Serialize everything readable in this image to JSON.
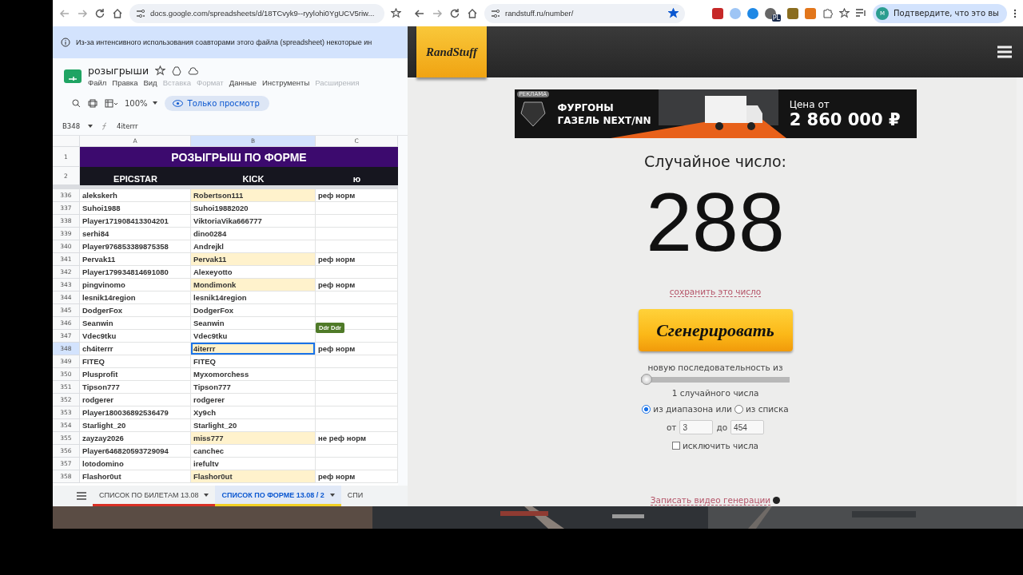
{
  "sheets_window": {
    "address": "docs.google.com/spreadsheets/d/18TCvyk9--ryylohi0YgUCV5riw...",
    "notice": "Из-за интенсивного использования соавторами этого файла (spreadsheet) некоторые ин",
    "doc_title": "розыгрыши",
    "menu": [
      {
        "label": "Файл",
        "disabled": false
      },
      {
        "label": "Правка",
        "disabled": false
      },
      {
        "label": "Вид",
        "disabled": false
      },
      {
        "label": "Вставка",
        "disabled": true
      },
      {
        "label": "Формат",
        "disabled": true
      },
      {
        "label": "Данные",
        "disabled": false
      },
      {
        "label": "Инструменты",
        "disabled": false
      },
      {
        "label": "Расширения",
        "disabled": true
      }
    ],
    "zoom": "100%",
    "view_mode": "Только просмотр",
    "cell_ref": "B348",
    "formula": "4iterrr",
    "columns": [
      {
        "label": "A",
        "selected": false
      },
      {
        "label": "B",
        "selected": true
      },
      {
        "label": "C",
        "selected": false
      }
    ],
    "title_row": {
      "number": "1",
      "text": "РОЗЫГРЫШ ПО ФОРМЕ"
    },
    "header_row": {
      "number": "2",
      "cells": [
        "EPICSTAR",
        "KICK",
        "ю"
      ]
    },
    "rows": [
      {
        "number": "336",
        "a": "alekskerh",
        "b": "Robertson111",
        "c": "реф норм",
        "highlighted": true,
        "selected": false
      },
      {
        "number": "337",
        "a": "Suhoi1988",
        "b": "Suhoi19882020",
        "highlighted": false,
        "selected": false
      },
      {
        "number": "338",
        "a": "Player171908413304201",
        "b": "ViktoriaVika666777",
        "highlighted": false,
        "selected": false
      },
      {
        "number": "339",
        "a": "serhi84",
        "b": "dino0284",
        "highlighted": false,
        "selected": false
      },
      {
        "number": "340",
        "a": "Player976853389875358",
        "b": "Andrejkl",
        "highlighted": false,
        "selected": false
      },
      {
        "number": "341",
        "a": "Pervak11",
        "b": "Pervak11",
        "c": "реф норм",
        "highlighted": true,
        "selected": false
      },
      {
        "number": "342",
        "a": "Player179934814691080",
        "b": "Alexeyotto",
        "highlighted": false,
        "selected": false
      },
      {
        "number": "343",
        "a": "pingvinomo",
        "b": "Mondimonk",
        "c": "реф норм",
        "highlighted": true,
        "selected": false
      },
      {
        "number": "344",
        "a": "lesnik14region",
        "b": "lesnik14region",
        "highlighted": false,
        "selected": false
      },
      {
        "number": "345",
        "a": "DodgerFox",
        "b": "DodgerFox",
        "highlighted": false,
        "selected": false
      },
      {
        "number": "346",
        "a": "Seanwin",
        "b": "Seanwin",
        "highlighted": false,
        "selected": false
      },
      {
        "number": "347",
        "a": "Vdec9tku",
        "b": "Vdec9tku",
        "flag": "Ddr Ddr",
        "highlighted": false,
        "selected": false
      },
      {
        "number": "348",
        "a": "ch4iterrr",
        "b": "4iterrr",
        "c": "реф норм",
        "highlighted": true,
        "selected": true
      },
      {
        "number": "349",
        "a": "FITEQ",
        "b": "FITEQ",
        "highlighted": false,
        "selected": false
      },
      {
        "number": "350",
        "a": "Plusprofit",
        "b": "Myxomorchess",
        "highlighted": false,
        "selected": false
      },
      {
        "number": "351",
        "a": "Tipson777",
        "b": "Tipson777",
        "highlighted": false,
        "selected": false
      },
      {
        "number": "352",
        "a": "rodgerer",
        "b": "rodgerer",
        "highlighted": false,
        "selected": false
      },
      {
        "number": "353",
        "a": "Player180036892536479",
        "b": "Xy9ch",
        "highlighted": false,
        "selected": false
      },
      {
        "number": "354",
        "a": "Starlight_20",
        "b": "Starlight_20",
        "highlighted": false,
        "selected": false
      },
      {
        "number": "355",
        "a": "zayzay2026",
        "b": "miss777",
        "c": "не реф норм",
        "highlighted": true,
        "selected": false
      },
      {
        "number": "356",
        "a": "Player646820593729094",
        "b": "canchec",
        "highlighted": false,
        "selected": false
      },
      {
        "number": "357",
        "a": "lotodomino",
        "b": "irefultv",
        "highlighted": false,
        "selected": false
      },
      {
        "number": "358",
        "a": "Flashor0ut",
        "b": "Flashor0ut",
        "c": "реф норм",
        "highlighted": true,
        "selected": false
      }
    ],
    "sheet_tabs": [
      {
        "label": "СПИСОК ПО БИЛЕТАМ 13.08",
        "selected": false,
        "color": "#d93025"
      },
      {
        "label": "СПИСОК ПО ФОРМЕ 13.08 / 2",
        "selected": true,
        "color": "#f2d024"
      },
      {
        "label": "СПИ",
        "selected": false
      }
    ]
  },
  "randstuff_window": {
    "address": "randstuff.ru/number/",
    "extension_badge": "PL",
    "avatar_letter": "M",
    "profile": "Подтвердите, что это вы",
    "logo": "RandStuff",
    "ad": {
      "badge": "РЕКЛАМА",
      "line1": "ФУРГОНЫ",
      "line2": "ГАЗЕЛЬ NEXT/NN",
      "price_label": "Цена от",
      "price": "2 860 000 ₽"
    },
    "heading": "Случайное число:",
    "result": "288",
    "save_link": "сохранить это число",
    "generate": "Сгенерировать",
    "sequence_label": "новую последовательность из",
    "count": {
      "level": 0
    },
    "count_label": "1 случайного числа",
    "sources": [
      {
        "label": "из диапазона или",
        "selected": true
      },
      {
        "label": "из списка",
        "selected": false
      }
    ],
    "from_label": "от",
    "from": "3",
    "to_label": "до",
    "to": "454",
    "exclude": {
      "label": "исключить числа",
      "checked": false
    },
    "video_link": "Записать видео генерации"
  }
}
